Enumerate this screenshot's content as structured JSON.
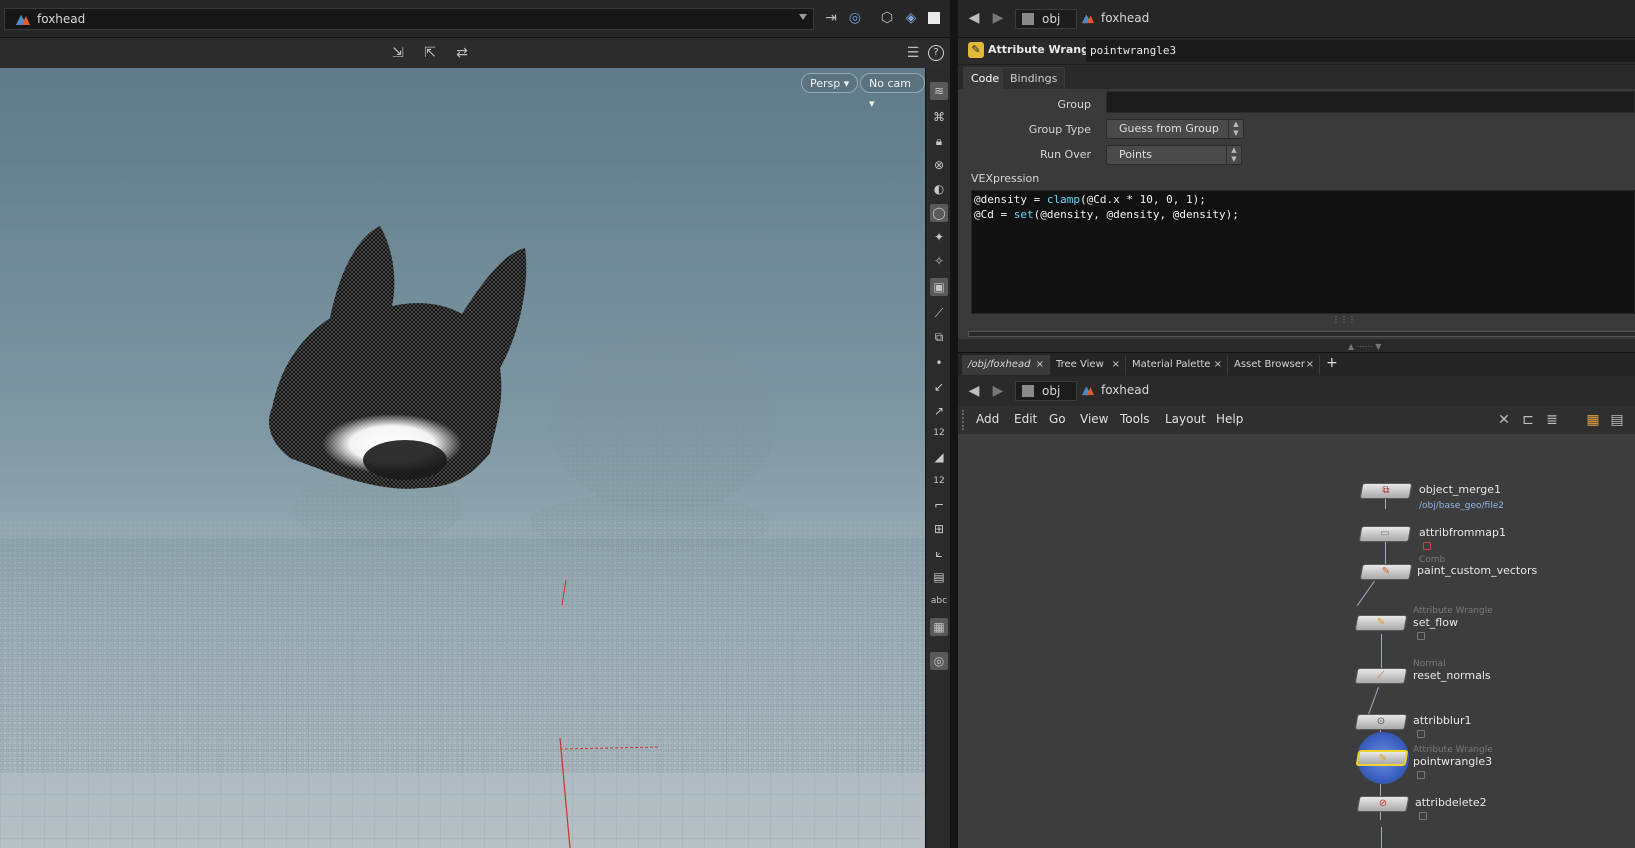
{
  "left": {
    "path": "foxhead",
    "viewport": {
      "persp_label": "Persp",
      "cam_label": "No cam"
    },
    "side_text": "abc",
    "side_num1": "12",
    "side_num2": "12"
  },
  "right": {
    "breadcrumb": {
      "root": "obj",
      "current": "foxhead"
    },
    "param": {
      "node_type": "Attribute Wrangle",
      "node_name": "pointwrangle3",
      "tabs": [
        "Code",
        "Bindings"
      ],
      "group_label": "Group",
      "group_value": "",
      "group_type_label": "Group Type",
      "group_type_value": "Guess from Group",
      "run_over_label": "Run Over",
      "run_over_value": "Points",
      "vex_label": "VEXpression",
      "code_line1": {
        "a": "@density = ",
        "fn": "clamp",
        "b": "(@Cd.x * 10, 0, 1);"
      },
      "code_line2": {
        "a": "@Cd = ",
        "fn": "set",
        "b": "(@density, @density, @density);"
      }
    },
    "net_tabs": [
      "/obj/foxhead",
      "Tree View",
      "Material Palette",
      "Asset Browser"
    ],
    "net_breadcrumb": {
      "root": "obj",
      "current": "foxhead"
    },
    "net_menu": [
      "Add",
      "Edit",
      "Go",
      "View",
      "Tools",
      "Layout",
      "Help"
    ],
    "nodes": [
      {
        "name": "object_merge1",
        "type": "",
        "sub": "/obj/base_geo/file2"
      },
      {
        "name": "attribfrommap1",
        "type": "",
        "sub": ""
      },
      {
        "name": "paint_custom_vectors",
        "type": "Comb",
        "sub": ""
      },
      {
        "name": "set_flow",
        "type": "Attribute Wrangle",
        "sub": ""
      },
      {
        "name": "reset_normals",
        "type": "Normal",
        "sub": ""
      },
      {
        "name": "attribblur1",
        "type": "",
        "sub": ""
      },
      {
        "name": "pointwrangle3",
        "type": "Attribute Wrangle",
        "sub": ""
      },
      {
        "name": "attribdelete2",
        "type": "",
        "sub": ""
      }
    ]
  },
  "colors": {
    "selected_node_ring": "#3b5fbf",
    "selected_outline": "#f2d430",
    "vex_function": "#6ad7f5",
    "link_blue": "#8fb6e8"
  }
}
